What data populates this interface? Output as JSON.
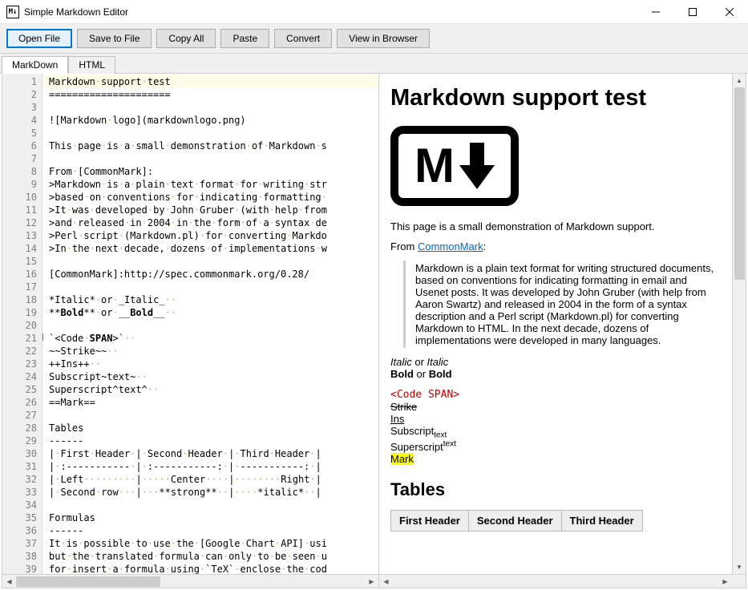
{
  "window": {
    "title": "Simple Markdown Editor",
    "icon_text": "M↓"
  },
  "toolbar": {
    "open": "Open File",
    "save": "Save to File",
    "copy": "Copy All",
    "paste": "Paste",
    "convert": "Convert",
    "view": "View in Browser"
  },
  "tabs": {
    "markdown": "MarkDown",
    "html": "HTML"
  },
  "editor": {
    "lines": [
      "Markdown·support·test",
      "=====================",
      "",
      "![Markdown·logo](markdownlogo.png)",
      "",
      "This·page·is·a·small·demonstration·of·Markdown·s",
      "",
      "From·[CommonMark]:",
      ">Markdown·is·a·plain·text·format·for·writing·str",
      ">based·on·conventions·for·indicating·formatting·",
      ">It·was·developed·by·John·Gruber·(with·help·from",
      ">and·released·in·2004·in·the·form·of·a·syntax·de",
      ">Perl·script·(Markdown.pl)·for·converting·Markdo",
      ">In·the·next·decade,·dozens·of·implementations·w",
      "",
      "[CommonMark]:http://spec.commonmark.org/0.28/",
      "",
      "*Italic*·or·_Italic_··",
      "**Bold**·or·__Bold__··",
      "",
      "`<Code·SPAN>`··",
      "~~Strike~~··",
      "++Ins++··",
      "Subscript~text~··",
      "Superscript^text^··",
      "==Mark==",
      "",
      "Tables",
      "------",
      "|·First·Header·|·Second·Header·|·Third·Header·|",
      "|·:-----------·|·:-----------:·|·-----------:·|",
      "|·Left·········|·····Center····|········Right·|",
      "|·Second·row···|···**strong**··|····*italic*··|",
      "",
      "Formulas",
      "------",
      "It·is·possible·to·use·the·[Google·Chart·API]·usi",
      "but·the·translated·formula·can·only·to·be·seen·u",
      "for·insert·a·formula·using·`TeX`·enclose·the·cod"
    ],
    "bold_line_index": 18,
    "fold_line_index": 20,
    "code_span_line_index": 20
  },
  "preview": {
    "h1": "Markdown support test",
    "logo_alt": "Markdown logo",
    "intro": "This page is a small demonstration of Markdown support.",
    "from_prefix": "From ",
    "from_link": "CommonMark",
    "from_suffix": ":",
    "blockquote": "Markdown is a plain text format for writing structured documents, based on conventions for indicating formatting in email and Usenet posts. It was developed by John Gruber (with help from Aaron Swartz) and released in 2004 in the form of a syntax description and a Perl script (Markdown.pl) for converting Markdown to HTML. In the next decade, dozens of implementations were developed in many languages.",
    "italic_line_1": "Italic",
    "italic_or": " or ",
    "italic_line_2": "Italic",
    "bold_line_1": "Bold",
    "bold_or": " or ",
    "bold_line_2": "Bold",
    "codespan": "<Code SPAN>",
    "strike": "Strike",
    "ins": "Ins",
    "sub_prefix": "Subscript",
    "sub_text": "text",
    "sup_prefix": "Superscript",
    "sup_text": "text",
    "mark": "Mark",
    "tables_heading": "Tables",
    "headers": [
      "First Header",
      "Second Header",
      "Third Header"
    ]
  }
}
